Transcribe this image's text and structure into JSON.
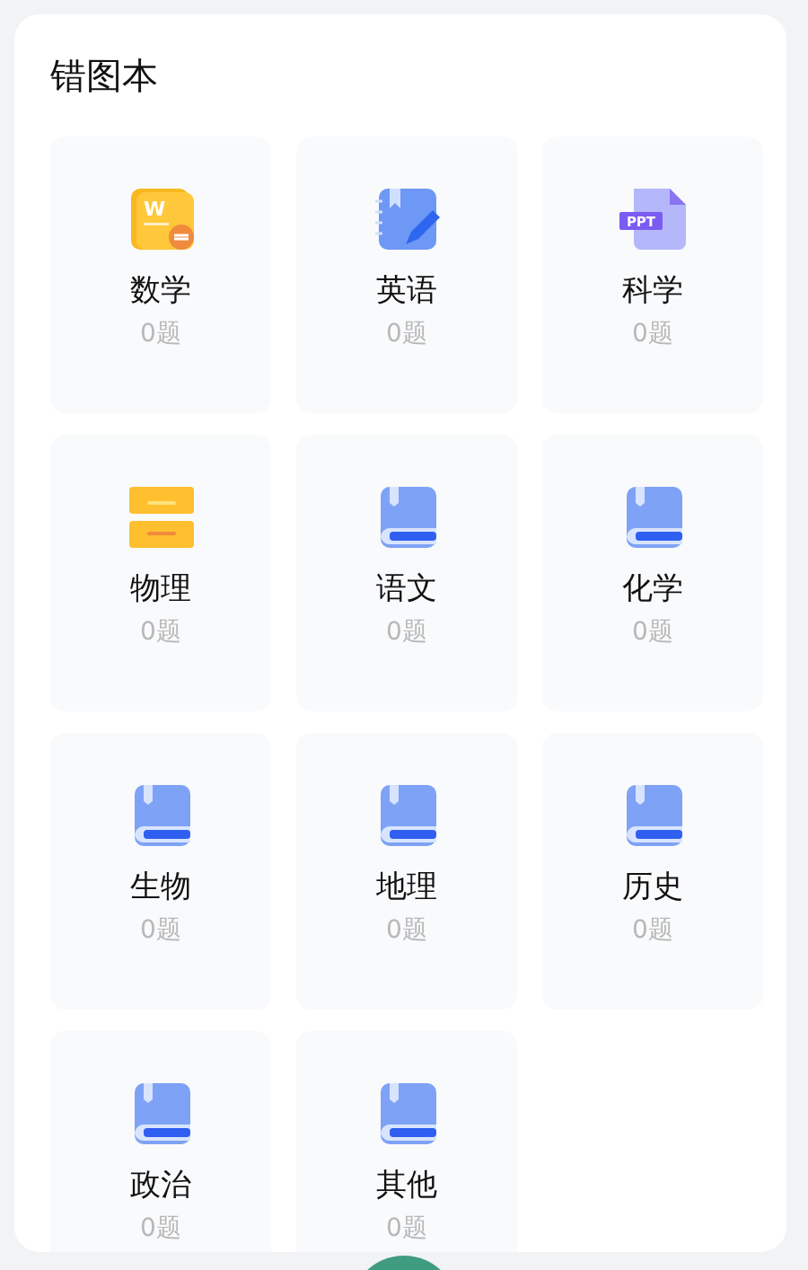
{
  "title": "错图本",
  "subjects": [
    {
      "name": "数学",
      "count": "0题",
      "kind": "document",
      "icon_text": "W"
    },
    {
      "name": "英语",
      "count": "0题",
      "kind": "notebook"
    },
    {
      "name": "科学",
      "count": "0题",
      "kind": "slides",
      "icon_text": "PPT"
    },
    {
      "name": "物理",
      "count": "0题",
      "kind": "drawer"
    },
    {
      "name": "语文",
      "count": "0题",
      "kind": "book"
    },
    {
      "name": "化学",
      "count": "0题",
      "kind": "book"
    },
    {
      "name": "生物",
      "count": "0题",
      "kind": "book"
    },
    {
      "name": "地理",
      "count": "0题",
      "kind": "book"
    },
    {
      "name": "历史",
      "count": "0题",
      "kind": "book"
    },
    {
      "name": "政治",
      "count": "0题",
      "kind": "book"
    },
    {
      "name": "其他",
      "count": "0题",
      "kind": "book"
    }
  ]
}
